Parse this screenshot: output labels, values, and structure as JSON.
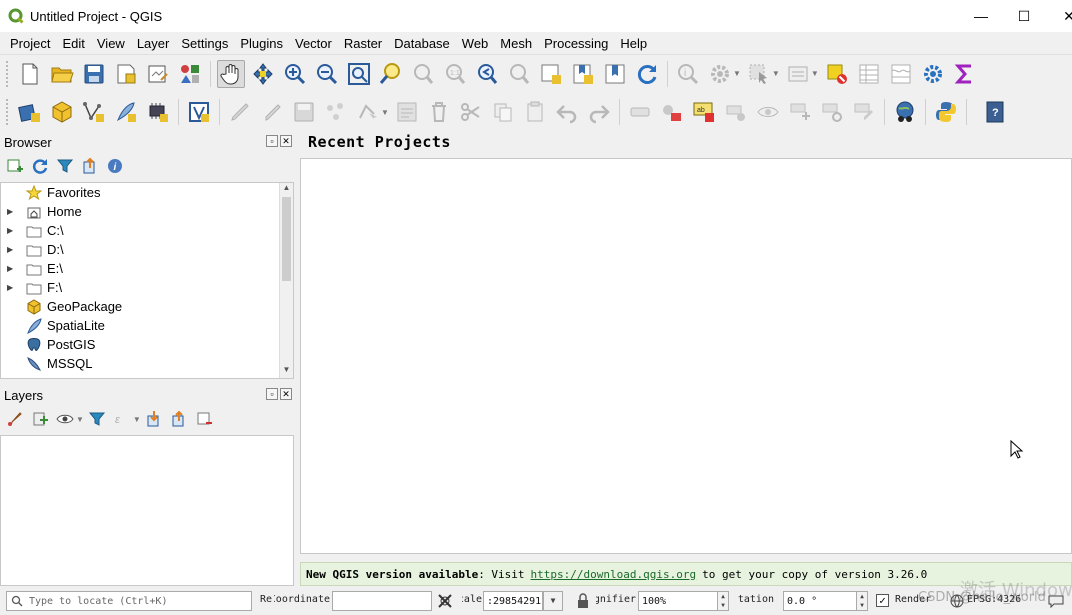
{
  "window": {
    "title": "Untitled Project - QGIS",
    "minimize": "—",
    "maximize": "☐",
    "close": "✕"
  },
  "menu": [
    "Project",
    "Edit",
    "View",
    "Layer",
    "Settings",
    "Plugins",
    "Vector",
    "Raster",
    "Database",
    "Web",
    "Mesh",
    "Processing",
    "Help"
  ],
  "browser": {
    "title": "Browser",
    "items": [
      {
        "label": "Favorites",
        "icon": "star-icon"
      },
      {
        "label": "Home",
        "icon": "home-folder-icon"
      },
      {
        "label": "C:\\",
        "icon": "folder-icon"
      },
      {
        "label": "D:\\",
        "icon": "folder-icon"
      },
      {
        "label": "E:\\",
        "icon": "folder-icon"
      },
      {
        "label": "F:\\",
        "icon": "folder-icon"
      },
      {
        "label": "GeoPackage",
        "icon": "geopackage-icon"
      },
      {
        "label": "SpatiaLite",
        "icon": "spatialite-icon"
      },
      {
        "label": "PostGIS",
        "icon": "postgis-icon"
      },
      {
        "label": "MSSQL",
        "icon": "mssql-icon"
      }
    ]
  },
  "layers": {
    "title": "Layers"
  },
  "recent": {
    "title": "Recent Projects"
  },
  "notice": {
    "prefix": "New QGIS version available",
    "mid": ": Visit",
    "link": "https://download.qgis.org",
    "suffix": "to get your copy of version 3.26.0"
  },
  "status": {
    "locate_placeholder": "Type to locate (Ctrl+K)",
    "coord_label": "Coordinate",
    "coord_label_prefix": "Re",
    "coordinate_value": "",
    "scale_label": "Scale",
    "scale_value": ":29854291",
    "magnifier_label": "Magnifier",
    "magnifier_value": "100%",
    "rotation_label": "Rotation",
    "rotation_value": "0.0 °",
    "render_label": "Render",
    "crs": "EPSG:4326"
  },
  "watermark": {
    "line1": "激活 Windows",
    "line2": "CSDN @hello_world"
  }
}
